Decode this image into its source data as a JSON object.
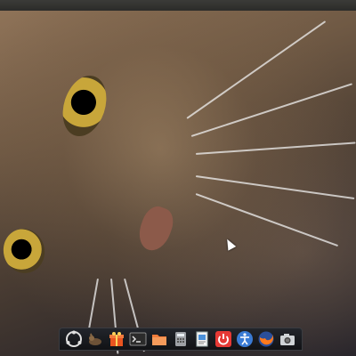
{
  "desktop": {
    "wallpaper": "cat-photo",
    "cursor_icon": "arrow-cursor-icon"
  },
  "dock": {
    "items": [
      {
        "icon": "ubuntu-logo-icon",
        "color": "#e95420"
      },
      {
        "icon": "kitty-icon",
        "color": "#7b5b3a"
      },
      {
        "icon": "gift-box-icon",
        "color": "#e95420"
      },
      {
        "icon": "terminal-icon",
        "color": "#2b2b2b"
      },
      {
        "icon": "folder-icon",
        "color": "#f07c3b"
      },
      {
        "icon": "calculator-icon",
        "color": "#9ea1a6"
      },
      {
        "icon": "document-viewer-icon",
        "color": "#4a90d9"
      },
      {
        "icon": "power-button-icon",
        "color": "#e53935"
      },
      {
        "icon": "accessibility-icon",
        "color": "#3a7bd5"
      },
      {
        "icon": "firefox-icon",
        "color": "#ff7a1c"
      },
      {
        "icon": "camera-icon",
        "color": "#cfd3d6"
      }
    ]
  }
}
